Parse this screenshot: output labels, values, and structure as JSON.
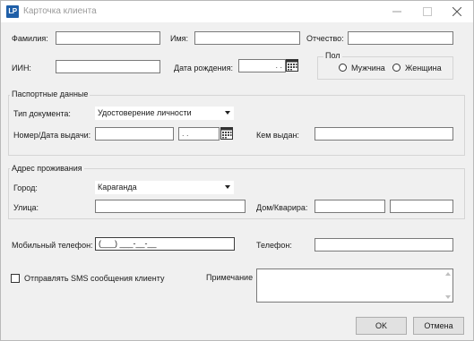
{
  "window": {
    "logo": "LP",
    "title": "Карточка клиента",
    "minimize_icon": "minimize-icon",
    "maximize_icon": "maximize-icon",
    "close_icon": "close-icon"
  },
  "person": {
    "last_name_label": "Фамилия:",
    "last_name_value": "",
    "first_name_label": "Имя:",
    "first_name_value": "",
    "patronymic_label": "Отчество:",
    "patronymic_value": "",
    "iin_label": "ИИН:",
    "iin_value": "",
    "birth_date_label": "Дата рождения:",
    "birth_date_value": ". .",
    "gender_group_title": "Пол",
    "gender_options": [
      "Мужчина",
      "Женщина"
    ],
    "gender_selected": ""
  },
  "passport": {
    "group_title": "Паспортные данные",
    "doc_type_label": "Тип документа:",
    "doc_type_value": "Удостоверение личности",
    "number_date_label": "Номер/Дата выдачи:",
    "number_value": "",
    "issue_date_value": ". .",
    "issued_by_label": "Кем выдан:",
    "issued_by_value": ""
  },
  "address": {
    "group_title": "Адрес проживания",
    "city_label": "Город:",
    "city_value": "Караганда",
    "street_label": "Улица:",
    "street_value": "",
    "house_apt_label": "Дом/Кварира:",
    "house_value": "",
    "apartment_value": ""
  },
  "contacts": {
    "mobile_label": "Мобильный телефон:",
    "mobile_value": "(___) ___-__-__",
    "phone_label": "Телефон:",
    "phone_value": ""
  },
  "sms": {
    "checkbox_label": "Отправлять SMS сообщения клиенту",
    "checked": false
  },
  "note": {
    "label": "Примечание",
    "value": ""
  },
  "buttons": {
    "ok": "OK",
    "cancel": "Отмена"
  },
  "colors": {
    "logo_bg": "#1f5fa8",
    "window_bg": "#f0f0f0"
  }
}
